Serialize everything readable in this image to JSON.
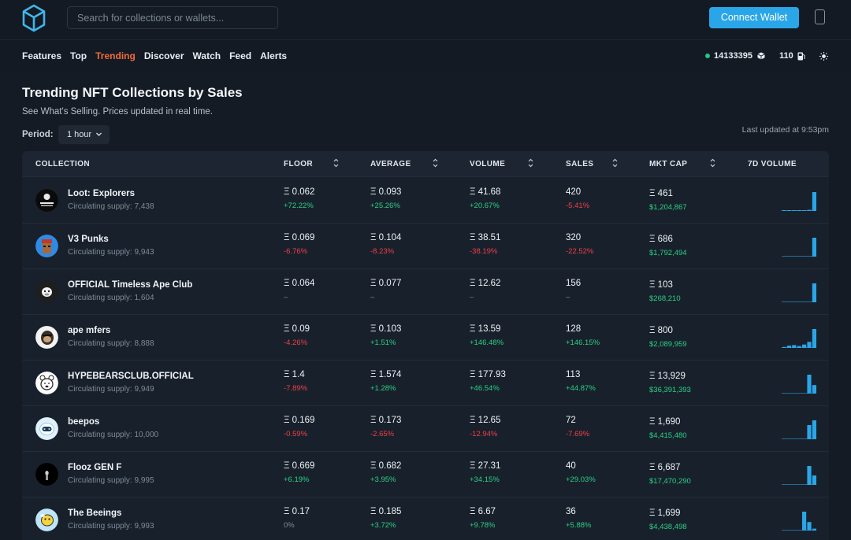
{
  "search": {
    "placeholder": "Search for collections or wallets..."
  },
  "header": {
    "connect_label": "Connect Wallet"
  },
  "nav": {
    "items": [
      "Features",
      "Top",
      "Trending",
      "Discover",
      "Watch",
      "Feed",
      "Alerts"
    ],
    "active": "Trending",
    "block_number": "14133395",
    "gas": "110"
  },
  "page": {
    "title": "Trending NFT Collections by Sales",
    "subtitle": "See What's Selling. Prices updated in real time.",
    "period_label": "Period:",
    "period_value": "1 hour",
    "last_updated": "Last updated at 9:53pm"
  },
  "table": {
    "columns": [
      "COLLECTION",
      "FLOOR",
      "AVERAGE",
      "VOLUME",
      "SALES",
      "MKT CAP",
      "7D VOLUME"
    ],
    "rows": [
      {
        "name": "Loot: Explorers",
        "supply": "Circulating supply: 7,438",
        "floor": "Ξ 0.062",
        "floor_chg": "+72.22%",
        "avg": "Ξ 0.093",
        "avg_chg": "+25.26%",
        "vol": "Ξ 41.68",
        "vol_chg": "+20.67%",
        "sales": "420",
        "sales_chg": "-5.41%",
        "mcap": "Ξ 461",
        "mcap_usd": "$1,204,867",
        "spark": [
          0.04,
          0.04,
          0.04,
          0.04,
          0.04,
          0.06,
          1.0
        ]
      },
      {
        "name": "V3 Punks",
        "supply": "Circulating supply: 9,943",
        "floor": "Ξ 0.069",
        "floor_chg": "-6.76%",
        "avg": "Ξ 0.104",
        "avg_chg": "-8.23%",
        "vol": "Ξ 38.51",
        "vol_chg": "-38.19%",
        "sales": "320",
        "sales_chg": "-22.52%",
        "mcap": "Ξ 686",
        "mcap_usd": "$1,792,494",
        "spark": [
          0,
          0,
          0,
          0,
          0,
          0,
          1.0
        ]
      },
      {
        "name": "OFFICIAL Timeless Ape Club",
        "supply": "Circulating supply: 1,604",
        "floor": "Ξ 0.064",
        "floor_chg": "–",
        "avg": "Ξ 0.077",
        "avg_chg": "–",
        "vol": "Ξ 12.62",
        "vol_chg": "–",
        "sales": "156",
        "sales_chg": "–",
        "mcap": "Ξ 103",
        "mcap_usd": "$268,210",
        "spark": [
          0,
          0,
          0,
          0,
          0,
          0,
          1.0
        ]
      },
      {
        "name": "ape mfers",
        "supply": "Circulating supply: 8,888",
        "floor": "Ξ 0.09",
        "floor_chg": "-4.26%",
        "avg": "Ξ 0.103",
        "avg_chg": "+1.51%",
        "vol": "Ξ 13.59",
        "vol_chg": "+146.48%",
        "sales": "128",
        "sales_chg": "+146.15%",
        "mcap": "Ξ 800",
        "mcap_usd": "$2,089,959",
        "spark": [
          0.05,
          0.12,
          0.15,
          0.1,
          0.18,
          0.32,
          1.0
        ]
      },
      {
        "name": "HYPEBEARSCLUB.OFFICIAL",
        "supply": "Circulating supply: 9,949",
        "floor": "Ξ 1.4",
        "floor_chg": "-7.89%",
        "avg": "Ξ 1.574",
        "avg_chg": "+1.28%",
        "vol": "Ξ 177.93",
        "vol_chg": "+46.54%",
        "sales": "113",
        "sales_chg": "+44.87%",
        "mcap": "Ξ 13,929",
        "mcap_usd": "$36,391,393",
        "spark": [
          0,
          0,
          0,
          0,
          0,
          1.0,
          0.45
        ]
      },
      {
        "name": "beepos",
        "supply": "Circulating supply: 10,000",
        "floor": "Ξ 0.169",
        "floor_chg": "-0.59%",
        "avg": "Ξ 0.173",
        "avg_chg": "-2.65%",
        "vol": "Ξ 12.65",
        "vol_chg": "-12.94%",
        "sales": "72",
        "sales_chg": "-7.69%",
        "mcap": "Ξ 1,690",
        "mcap_usd": "$4,415,480",
        "spark": [
          0,
          0,
          0,
          0,
          0,
          0.75,
          1.0
        ]
      },
      {
        "name": "Flooz GEN F",
        "supply": "Circulating supply: 9,995",
        "floor": "Ξ 0.669",
        "floor_chg": "+6.19%",
        "avg": "Ξ 0.682",
        "avg_chg": "+3.95%",
        "vol": "Ξ 27.31",
        "vol_chg": "+34.15%",
        "sales": "40",
        "sales_chg": "+29.03%",
        "mcap": "Ξ 6,687",
        "mcap_usd": "$17,470,290",
        "spark": [
          0,
          0,
          0,
          0,
          0,
          1.0,
          0.5
        ]
      },
      {
        "name": "The Beeings",
        "supply": "Circulating supply: 9,993",
        "floor": "Ξ 0.17",
        "floor_chg": "0%",
        "avg": "Ξ 0.185",
        "avg_chg": "+3.72%",
        "vol": "Ξ 6.67",
        "vol_chg": "+9.78%",
        "sales": "36",
        "sales_chg": "+5.88%",
        "mcap": "Ξ 1,699",
        "mcap_usd": "$4,438,498",
        "spark": [
          0,
          0,
          0,
          0,
          1.0,
          0.45,
          0.1
        ]
      }
    ]
  },
  "colors": {
    "accent": "#2aa6e8",
    "active_nav": "#f46b3b",
    "positive": "#2ccf85",
    "negative": "#ef3e4a"
  }
}
